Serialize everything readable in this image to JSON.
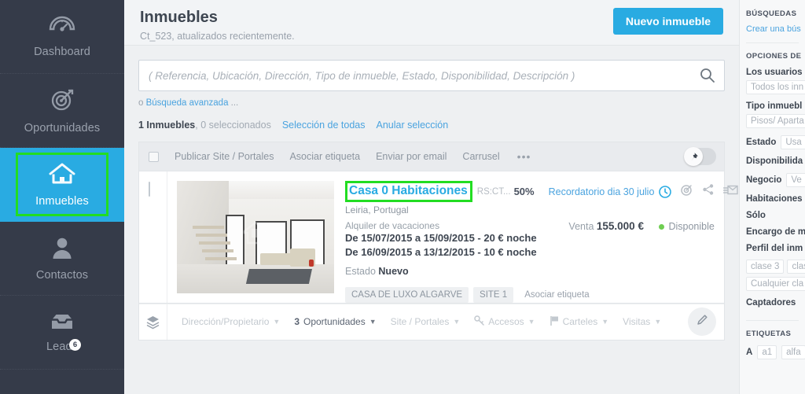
{
  "sidebar": {
    "items": [
      {
        "label": "Dashboard",
        "icon": "gauge-icon",
        "active": false,
        "badge": null
      },
      {
        "label": "Oportunidades",
        "icon": "target-icon",
        "active": false,
        "badge": null
      },
      {
        "label": "Inmuebles",
        "icon": "home-icon",
        "active": true,
        "badge": null
      },
      {
        "label": "Contactos",
        "icon": "user-icon",
        "active": false,
        "badge": null
      },
      {
        "label": "Leads",
        "icon": "inbox-icon",
        "active": false,
        "badge": "6"
      }
    ],
    "active_color": "#29abe2",
    "highlight_color": "#22dd22",
    "background": "#353b49"
  },
  "header": {
    "title": "Inmuebles",
    "subtitle": "Ct_523, atualizados recientemente.",
    "new_button": "Nuevo inmueble"
  },
  "search": {
    "placeholder": "( Referencia, Ubicación, Dirección, Tipo de inmueble, Estado, Disponibilidad, Descripción )",
    "value": "",
    "icon": "search-icon",
    "advanced_prefix": "o ",
    "advanced_link": "Búsqueda avanzada",
    "advanced_suffix": " ..."
  },
  "counts": {
    "total": "1 Inmuebles",
    "selected": ", 0 seleccionados",
    "select_all": "Selección de todas",
    "clear_selection": "Anular selección"
  },
  "toolbar": {
    "publish": "Publicar Site / Portales",
    "tag": "Asociar etiqueta",
    "email": "Enviar por email",
    "carousel": "Carrusel",
    "more": "•••",
    "pin_icon": "pin-icon"
  },
  "property": {
    "title": "Casa 0 Habitaciones",
    "reference": "RS:CT...",
    "progress_pct": "50%",
    "progress_value": 50,
    "reminder": "Recordatorio dia 30 julio",
    "reminder_icon": "clock-icon",
    "icons": [
      "target-icon",
      "share-icon",
      "email-out-icon",
      "pin-icon"
    ],
    "location": "Leiria, Portugal",
    "business_label": "Alquiler de vacaciones",
    "rental_lines": [
      "De 15/07/2015 a 15/09/2015 - 20 € noche",
      "De 16/09/2015 a 13/12/2015 - 10 € noche"
    ],
    "sale_label": "Venta",
    "sale_price": "155.000 €",
    "availability": "Disponible",
    "availability_color": "#6fce52",
    "state_label": "Estado",
    "state_value": "Nuevo",
    "tags": [
      "CASA DE LUXO ALGARVE",
      "SITE 1"
    ],
    "tag_link": "Asociar etiqueta",
    "photo_alt": "modern-living-room-interior"
  },
  "card_footer": {
    "layers_icon": "layers-icon",
    "items": [
      {
        "label": "Dirección/Propietario",
        "icon": null,
        "active": false,
        "count": null
      },
      {
        "label": "Oportunidades",
        "icon": null,
        "active": true,
        "count": "3"
      },
      {
        "label": "Site / Portales",
        "icon": null,
        "active": false,
        "count": null
      },
      {
        "label": "Accesos",
        "icon": "key-icon",
        "active": false,
        "count": null
      },
      {
        "label": "Carteles",
        "icon": "flag-icon",
        "active": false,
        "count": null
      },
      {
        "label": "Visitas",
        "icon": null,
        "active": false,
        "count": null
      }
    ],
    "edit_icon": "pencil-icon"
  },
  "right_panel": {
    "saved_searches_head": "BÚSQUEDAS",
    "create_search_link": "Crear una bús",
    "options_head": "OPCIONES DE",
    "fields": [
      {
        "label": "Los usuarios",
        "value": "Todos los inn",
        "inline": false
      },
      {
        "label": "Tipo inmuebl",
        "value": "Pisos/ Aparta",
        "inline": false
      },
      {
        "label": "Estado",
        "value": "Usa",
        "inline": true
      },
      {
        "label": "Disponibilida",
        "value": null,
        "inline": true
      },
      {
        "label": "Negocio",
        "value": "Ve",
        "inline": true
      },
      {
        "label": "Habitaciones",
        "value": null,
        "inline": true
      },
      {
        "label": "Sólo",
        "value": null,
        "inline": true
      },
      {
        "label": "Encargo de m",
        "value": null,
        "inline": true
      },
      {
        "label": "Perfil del inm",
        "value": null,
        "inline": false
      }
    ],
    "profile_chips": [
      "clase 3",
      "clas"
    ],
    "profile_any": "Cualquier cla",
    "captadores_label": "Captadores",
    "tags_head": "ETIQUETAS",
    "tag_letter": "A",
    "tag_chips": [
      "a1",
      "alfa"
    ]
  }
}
